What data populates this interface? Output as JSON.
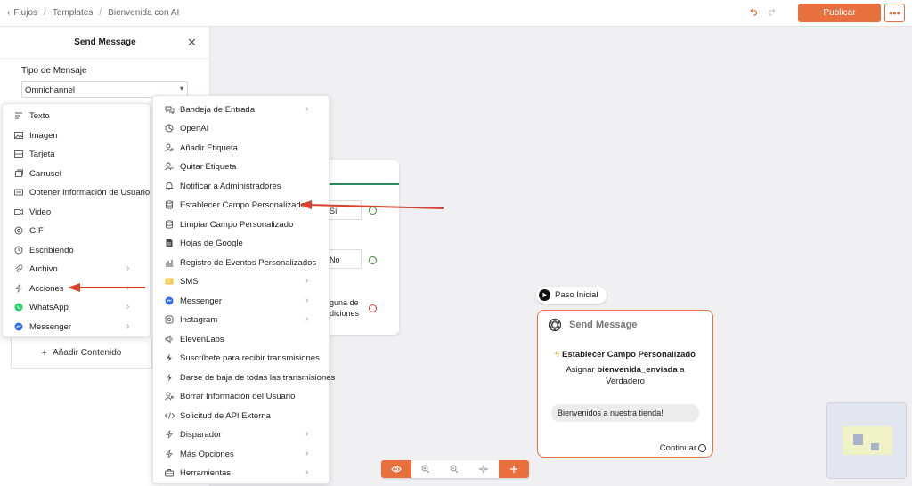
{
  "breadcrumb": {
    "items": [
      "Flujos",
      "Templates",
      "Bienvenida con AI"
    ]
  },
  "toolbar": {
    "publish_label": "Publicar",
    "more_label": "•••"
  },
  "panel": {
    "title": "Send Message",
    "type_label": "Tipo de Mensaje",
    "type_value": "Omnichannel",
    "add_content_label": "Añadir Contenido"
  },
  "content_menu": {
    "items": [
      {
        "label": "Texto",
        "icon": "text-icon"
      },
      {
        "label": "Imagen",
        "icon": "image-icon"
      },
      {
        "label": "Tarjeta",
        "icon": "card-icon"
      },
      {
        "label": "Carrusel",
        "icon": "carousel-icon"
      },
      {
        "label": "Obtener Información de Usuario",
        "icon": "user-info-icon"
      },
      {
        "label": "Video",
        "icon": "video-icon"
      },
      {
        "label": "GIF",
        "icon": "gif-icon"
      },
      {
        "label": "Escribiendo",
        "icon": "typing-icon"
      },
      {
        "label": "Archivo",
        "icon": "paperclip-icon",
        "submenu": true
      },
      {
        "label": "Acciones",
        "icon": "bolt-icon",
        "submenu": true
      },
      {
        "label": "WhatsApp",
        "icon": "whatsapp-icon",
        "submenu": true
      },
      {
        "label": "Messenger",
        "icon": "messenger-icon",
        "submenu": true
      }
    ]
  },
  "actions_menu": {
    "items": [
      {
        "label": "Bandeja de Entrada",
        "icon": "inbox-icon",
        "submenu": true
      },
      {
        "label": "OpenAI",
        "icon": "openai-icon"
      },
      {
        "label": "Añadir Etiqueta",
        "icon": "add-tag-icon"
      },
      {
        "label": "Quitar Etiqueta",
        "icon": "remove-tag-icon"
      },
      {
        "label": "Notificar a Administradores",
        "icon": "bell-icon"
      },
      {
        "label": "Establecer Campo Personalizado",
        "icon": "database-icon"
      },
      {
        "label": "Limpiar Campo Personalizado",
        "icon": "database-clear-icon"
      },
      {
        "label": "Hojas de Google",
        "icon": "google-sheets-icon"
      },
      {
        "label": "Registro de Eventos Personalizados",
        "icon": "chart-icon"
      },
      {
        "label": "SMS",
        "icon": "sms-icon",
        "submenu": true
      },
      {
        "label": "Messenger",
        "icon": "messenger-icon",
        "submenu": true
      },
      {
        "label": "Instagram",
        "icon": "instagram-icon",
        "submenu": true
      },
      {
        "label": "ElevenLabs",
        "icon": "audio-icon"
      },
      {
        "label": "Suscríbete para recibir transmisiones",
        "icon": "bolt-icon"
      },
      {
        "label": "Darse de baja de todas las transmisiones",
        "icon": "bolt-icon"
      },
      {
        "label": "Borrar Información del Usuario",
        "icon": "user-delete-icon"
      },
      {
        "label": "Solicitud de API Externa",
        "icon": "code-icon"
      },
      {
        "label": "Disparador",
        "icon": "bolt-icon",
        "submenu": true
      },
      {
        "label": "Más Opciones",
        "icon": "bolt-icon",
        "submenu": true
      },
      {
        "label": "Herramientas",
        "icon": "toolbox-icon",
        "submenu": true
      }
    ]
  },
  "canvas_card": {
    "option_yes": "Sí",
    "option_no": "No",
    "condition_line1": "guna de",
    "condition_line2": "diciones"
  },
  "start_pill": {
    "label": "Paso Inicial"
  },
  "node": {
    "title": "Send Message",
    "action": "Establecer Campo Personalizado",
    "desc_prefix": "Asignar",
    "desc_field": "bienvenida_enviada",
    "desc_mid": "a",
    "desc_value": "Verdadero",
    "message": "Bienvenidos a nuestra tienda!",
    "continue_label": "Continuar"
  },
  "colors": {
    "accent": "#e8703f",
    "green": "#2d8a5f",
    "arrow": "#d8412b"
  }
}
